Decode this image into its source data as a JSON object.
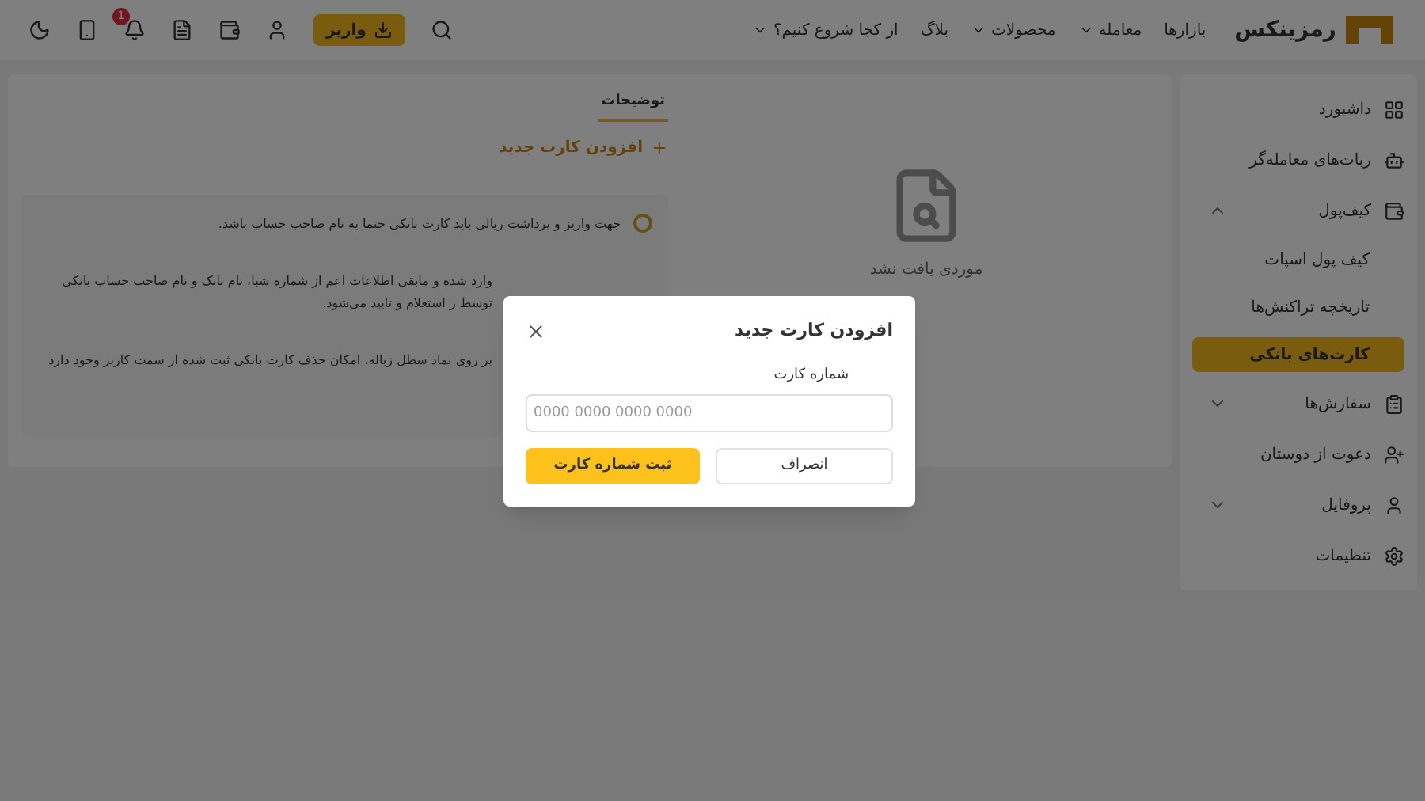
{
  "header": {
    "logo": "رمزینکس",
    "nav": [
      {
        "label": "بازارها",
        "dropdown": false
      },
      {
        "label": "معامله",
        "dropdown": true
      },
      {
        "label": "محصولات",
        "dropdown": true
      },
      {
        "label": "بلاگ",
        "dropdown": false
      },
      {
        "label": "از کجا شروع کنیم؟",
        "dropdown": true
      }
    ],
    "deposit_button": "واریز",
    "notification_count": "1"
  },
  "sidebar": {
    "items": [
      {
        "kind": "link",
        "label": "داشبورد"
      },
      {
        "kind": "link",
        "label": "ربات‌های معامله‌گر"
      },
      {
        "kind": "group",
        "label": "کیف‌پول",
        "expanded": true,
        "children": [
          {
            "label": "کیف پول اسپات",
            "selected": false
          },
          {
            "label": "تاریخچه تراکنش‌ها",
            "selected": false
          },
          {
            "label": "کارت‌های بانکی",
            "selected": true
          }
        ]
      },
      {
        "kind": "group",
        "label": "سفارش‌ها",
        "expanded": false
      },
      {
        "kind": "link",
        "label": "دعوت از دوستان"
      },
      {
        "kind": "group",
        "label": "پروفایل",
        "expanded": false
      },
      {
        "kind": "link",
        "label": "تنظیمات"
      }
    ]
  },
  "main": {
    "tabs": [
      {
        "label": "توضیحات",
        "selected": true
      }
    ],
    "add_card_button": "افزودن کارت جدید",
    "notes": [
      {
        "text": "جهت واریز و برداشت ریالی باید کارت بانکی حتما به نام صاحب حساب باشد.",
        "bullet": true
      },
      {
        "text": "وارد شده و مابقی اطلاعات اعم از شماره شبا، نام بانک و نام صاحب حساب بانکی توسط ر استعلام و تایید می‌شود.",
        "bullet": false
      },
      {
        "text": "بر روی نماد سطل زباله، امکان حذف کارت بانکی ثبت شده از سمت کاربر وجود دارد",
        "bullet": false
      }
    ],
    "empty_state": "موردی یافت نشد"
  },
  "dialog": {
    "title": "افزودن کارت جدید",
    "field_label": "شماره کارت",
    "placeholder": "0000 0000 0000 0000",
    "cancel_button": "انصراف",
    "submit_button": "ثبت شماره کارت"
  }
}
